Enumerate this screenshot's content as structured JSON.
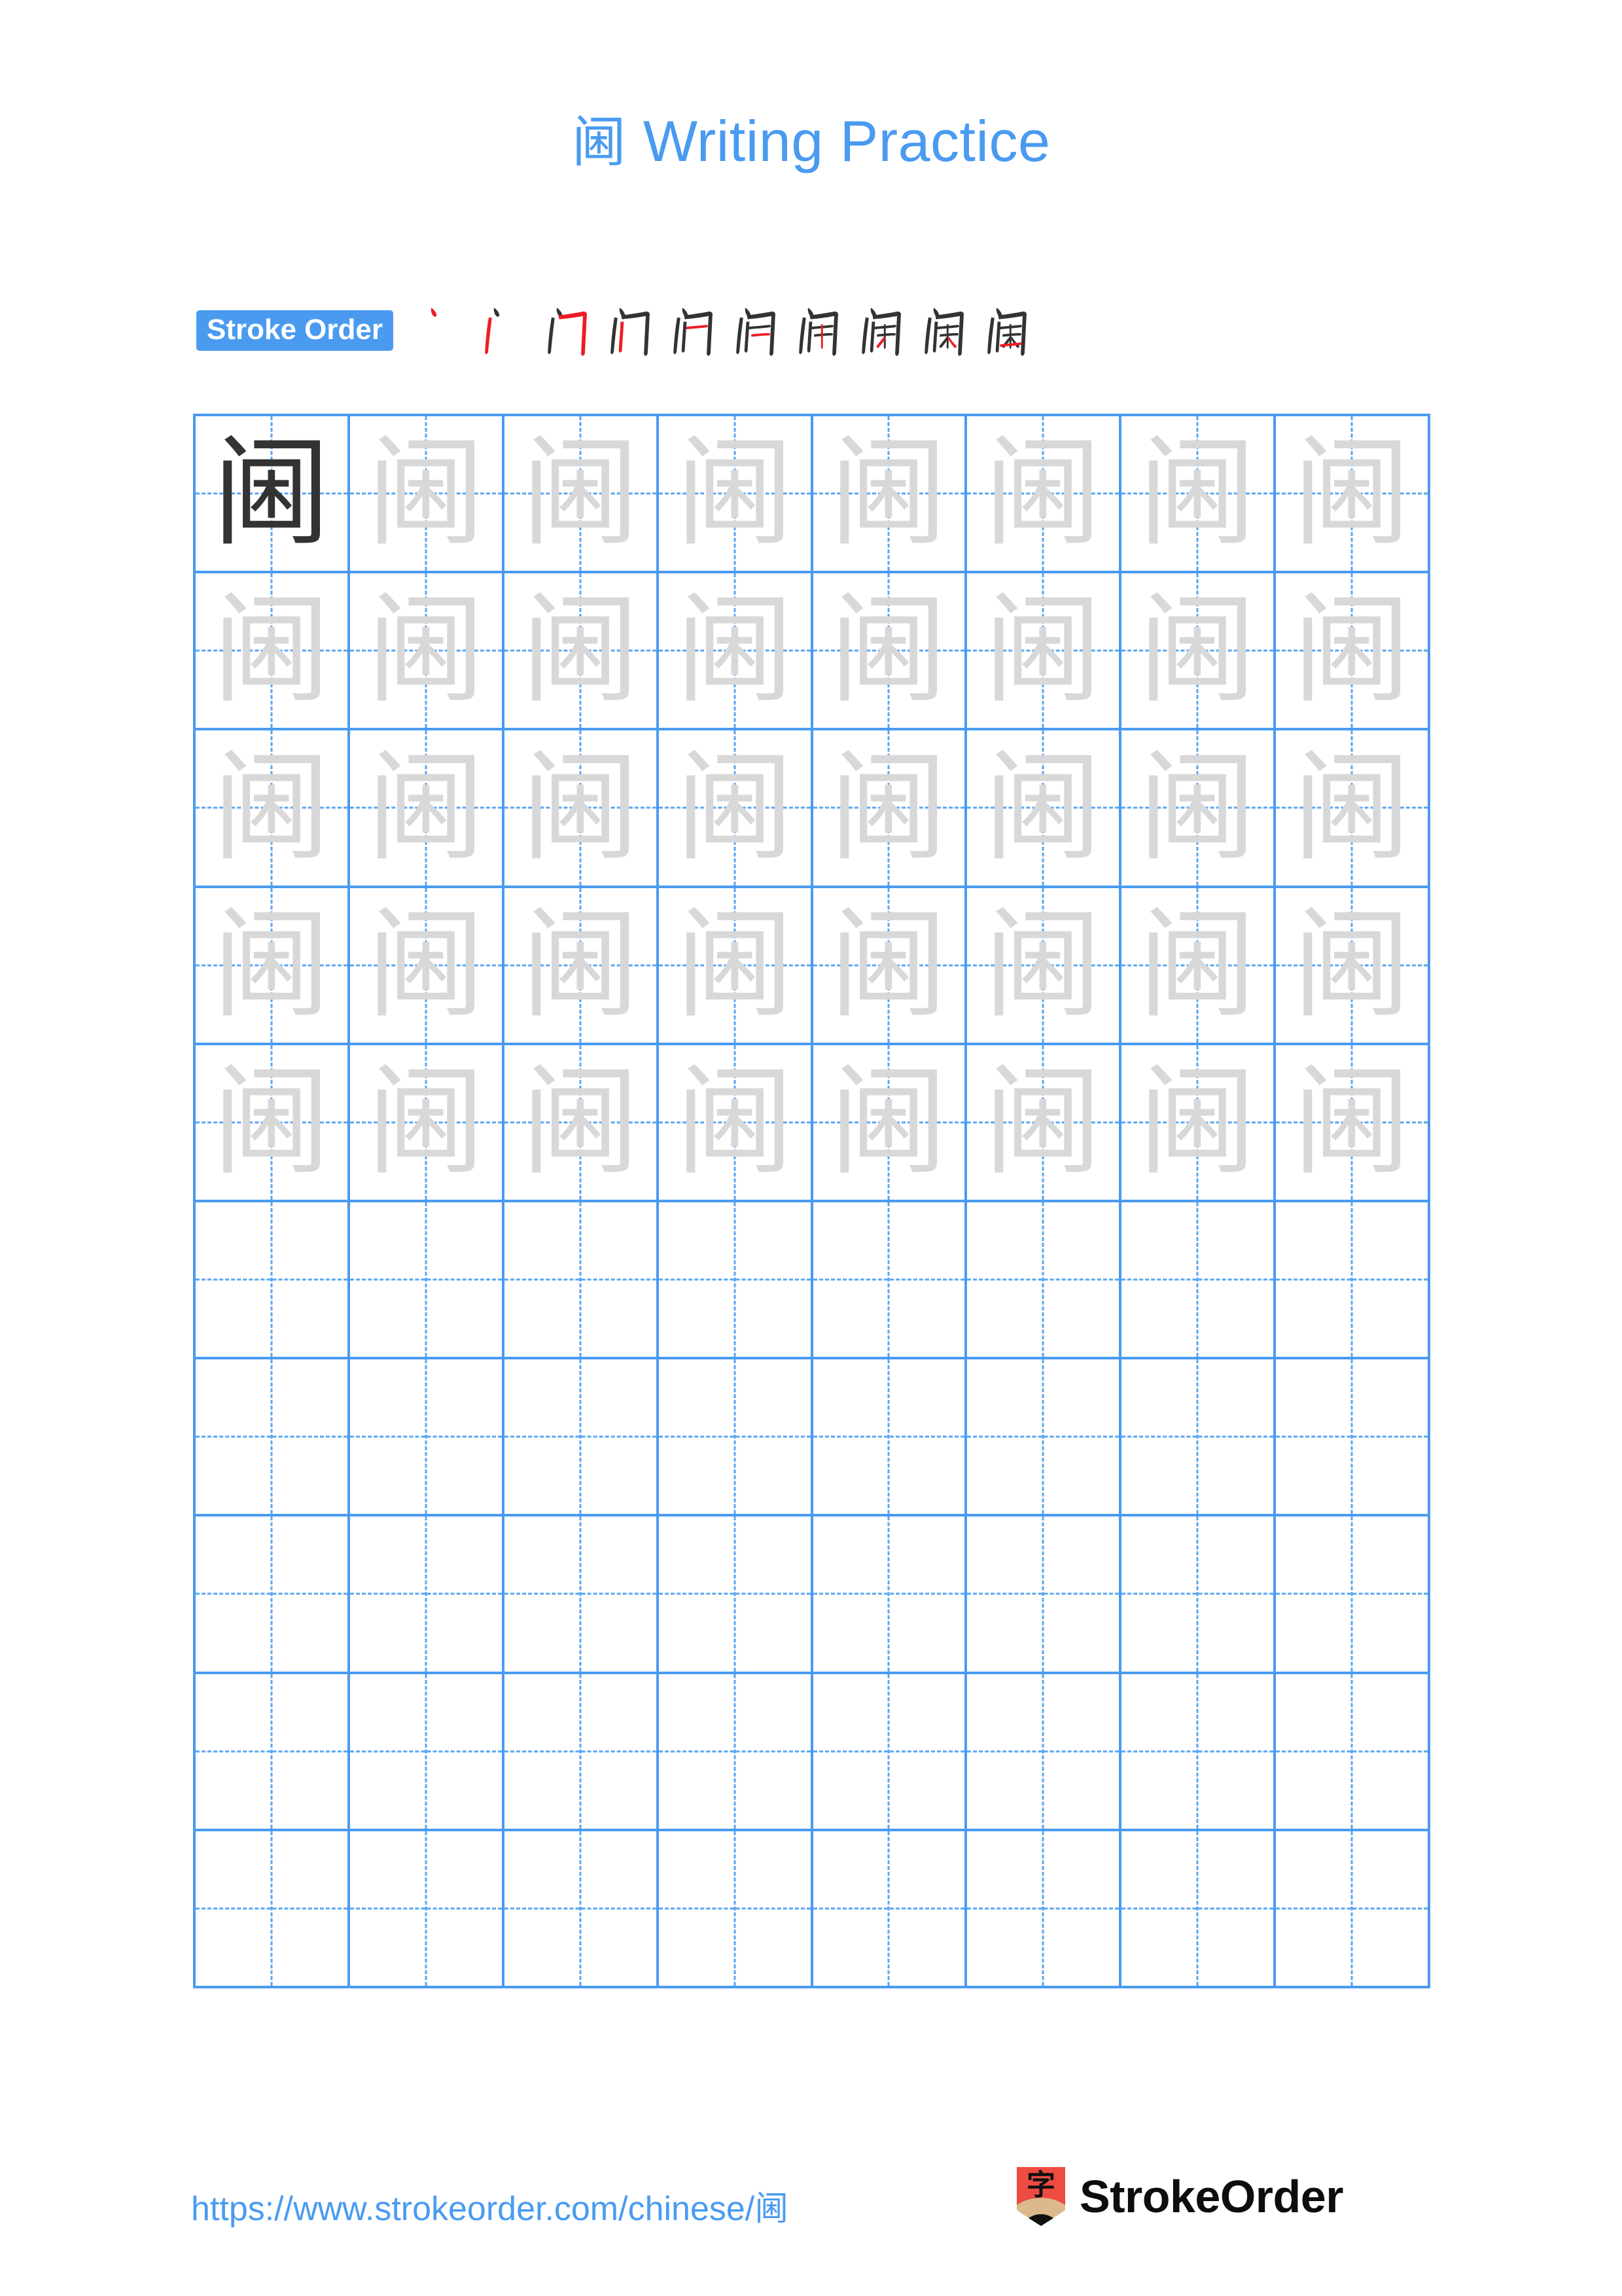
{
  "page": {
    "character": "阃",
    "title": "阃 Writing Practice",
    "title_prefix": "阃",
    "title_suffix": " Writing Practice",
    "background_color": "#ffffff",
    "accent_color": "#4a9bf0",
    "grid_line_color": "#4a9bf0",
    "guide_line_color": "#5aa6f2",
    "trace_color": "#d8d8d8",
    "ink_color": "#333333",
    "highlight_stroke_color": "#ee1c25"
  },
  "stroke_order": {
    "badge_label": "Stroke Order",
    "total_strokes": 10,
    "steps": [
      {
        "index": 1,
        "strokes_shown": 1,
        "new_stroke": "dian (dot)"
      },
      {
        "index": 2,
        "strokes_shown": 2,
        "new_stroke": "shu (vertical)"
      },
      {
        "index": 3,
        "strokes_shown": 3,
        "new_stroke": "heng-zhe-gou"
      },
      {
        "index": 4,
        "strokes_shown": 4,
        "new_stroke": "shu (vertical)"
      },
      {
        "index": 5,
        "strokes_shown": 5,
        "new_stroke": "heng (horizontal)"
      },
      {
        "index": 6,
        "strokes_shown": 6,
        "new_stroke": "heng (horizontal)"
      },
      {
        "index": 7,
        "strokes_shown": 7,
        "new_stroke": "shu (vertical)"
      },
      {
        "index": 8,
        "strokes_shown": 8,
        "new_stroke": "pie (left falling)"
      },
      {
        "index": 9,
        "strokes_shown": 9,
        "new_stroke": "na (right falling)"
      },
      {
        "index": 10,
        "strokes_shown": 10,
        "new_stroke": "heng (bottom closing)"
      }
    ]
  },
  "practice_grid": {
    "columns": 8,
    "rows": 10,
    "filled_rows": 5,
    "empty_rows": 5,
    "cells": [
      [
        "ink",
        "trace",
        "trace",
        "trace",
        "trace",
        "trace",
        "trace",
        "trace"
      ],
      [
        "trace",
        "trace",
        "trace",
        "trace",
        "trace",
        "trace",
        "trace",
        "trace"
      ],
      [
        "trace",
        "trace",
        "trace",
        "trace",
        "trace",
        "trace",
        "trace",
        "trace"
      ],
      [
        "trace",
        "trace",
        "trace",
        "trace",
        "trace",
        "trace",
        "trace",
        "trace"
      ],
      [
        "trace",
        "trace",
        "trace",
        "trace",
        "trace",
        "trace",
        "trace",
        "trace"
      ],
      [
        "empty",
        "empty",
        "empty",
        "empty",
        "empty",
        "empty",
        "empty",
        "empty"
      ],
      [
        "empty",
        "empty",
        "empty",
        "empty",
        "empty",
        "empty",
        "empty",
        "empty"
      ],
      [
        "empty",
        "empty",
        "empty",
        "empty",
        "empty",
        "empty",
        "empty",
        "empty"
      ],
      [
        "empty",
        "empty",
        "empty",
        "empty",
        "empty",
        "empty",
        "empty",
        "empty"
      ],
      [
        "empty",
        "empty",
        "empty",
        "empty",
        "empty",
        "empty",
        "empty",
        "empty"
      ]
    ]
  },
  "footer": {
    "url_text": "https://www.strokeorder.com/chinese/阃",
    "url_prefix": "https://www.strokeorder.com/chinese/",
    "url_character": "阃",
    "brand_name": "StrokeOrder",
    "logo_glyph": "字",
    "logo_body_color": "#ee4b42",
    "logo_wood_color": "#dcb98c",
    "logo_tip_color": "#111111"
  }
}
